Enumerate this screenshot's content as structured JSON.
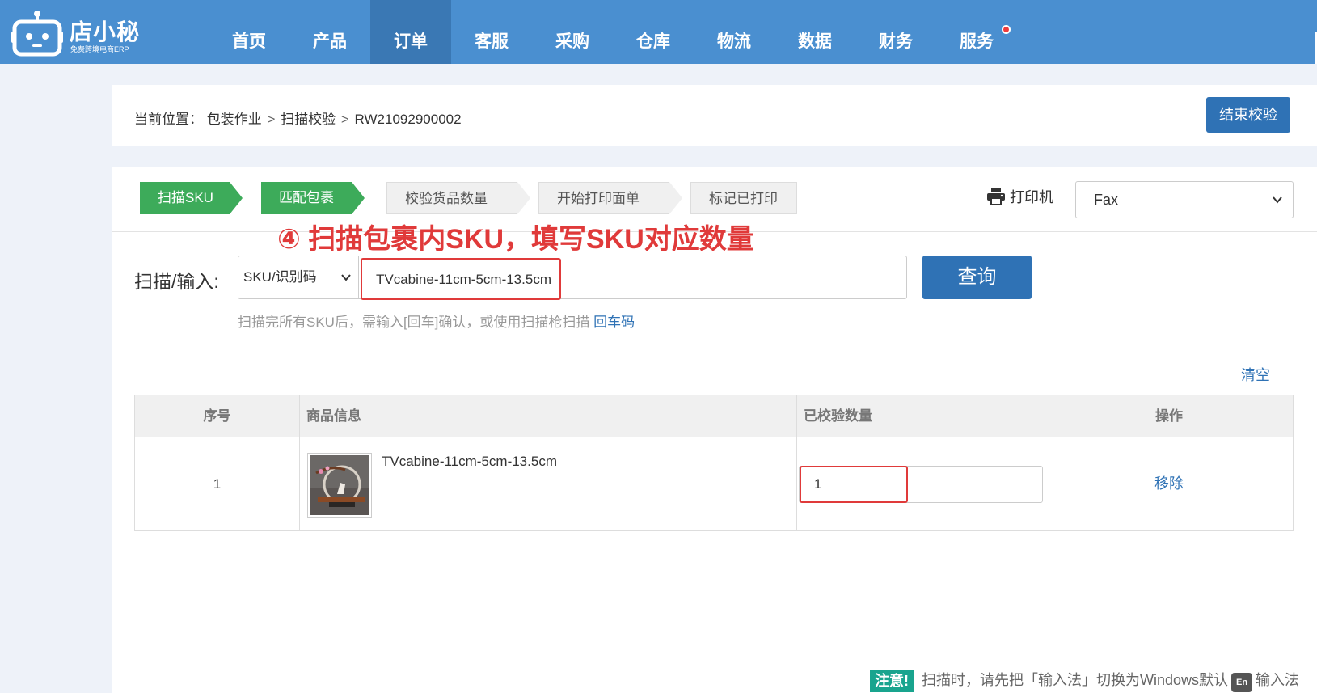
{
  "header": {
    "brand": "店小秘",
    "slogan": "免费跨境电商ERP",
    "nav": [
      {
        "label": "首页"
      },
      {
        "label": "产品"
      },
      {
        "label": "订单",
        "active": true
      },
      {
        "label": "客服"
      },
      {
        "label": "采购"
      },
      {
        "label": "仓库"
      },
      {
        "label": "物流"
      },
      {
        "label": "数据"
      },
      {
        "label": "财务"
      },
      {
        "label": "服务",
        "has_notification": true
      }
    ]
  },
  "breadcrumb": {
    "prefix": "当前位置：",
    "items": [
      "包装作业",
      "扫描校验",
      "RW21092900002"
    ],
    "separator": ">"
  },
  "end_button": "结束校验",
  "steps": [
    {
      "label": "扫描SKU",
      "status": "done"
    },
    {
      "label": "匹配包裹",
      "status": "done"
    },
    {
      "label": "校验货品数量",
      "status": "todo"
    },
    {
      "label": "开始打印面单",
      "status": "todo"
    },
    {
      "label": "标记已打印",
      "status": "todo"
    }
  ],
  "printer": {
    "label": "打印机",
    "selected": "Fax"
  },
  "annotation": "④ 扫描包裹内SKU，填写SKU对应数量",
  "scan": {
    "label": "扫描/输入:",
    "type_selected": "SKU/识别码",
    "value": "TVcabine-11cm-5cm-13.5cm",
    "query_button": "查询",
    "hint": "扫描完所有SKU后，需输入[回车]确认，或使用扫描枪扫描",
    "hint_link": "回车码"
  },
  "clear_link": "清空",
  "table": {
    "headers": [
      "序号",
      "商品信息",
      "已校验数量",
      "操作"
    ],
    "rows": [
      {
        "index": "1",
        "name": "TVcabine-11cm-5cm-13.5cm",
        "qty": "1",
        "action": "移除"
      }
    ]
  },
  "notice": {
    "tag": "注意!",
    "text_before": "扫描时，请先把「输入法」切换为Windows默认",
    "en_badge": "En",
    "text_after": "输入法"
  },
  "colors": {
    "header_bg": "#4a8fd0",
    "nav_active": "#3a78b4",
    "primary": "#2f72b5",
    "step_done": "#3dab5a",
    "annotation_red": "#e03a3a",
    "notice_tag": "#19a48e"
  }
}
